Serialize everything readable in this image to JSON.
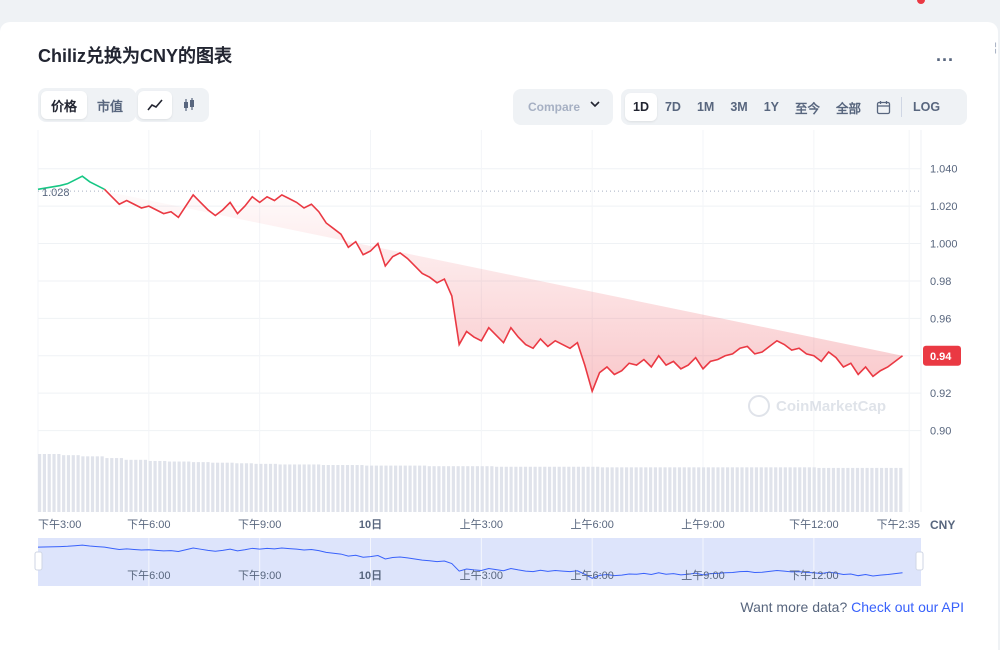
{
  "title": "Chiliz兑换为CNY的图表",
  "more_label": "...",
  "view_tabs": [
    {
      "label": "价格",
      "active": true
    },
    {
      "label": "市值",
      "active": false
    }
  ],
  "chart_type_icons": [
    "line-chart-icon",
    "candlestick-icon"
  ],
  "compare": {
    "label": "Compare"
  },
  "ranges": [
    {
      "label": "1D",
      "active": true
    },
    {
      "label": "7D",
      "active": false
    },
    {
      "label": "1M",
      "active": false
    },
    {
      "label": "3M",
      "active": false
    },
    {
      "label": "1Y",
      "active": false
    },
    {
      "label": "至今",
      "active": false
    },
    {
      "label": "全部",
      "active": false
    }
  ],
  "log_label": "LOG",
  "footer": {
    "text": "Want more data?",
    "link": "Check out our API"
  },
  "watermark": "CoinMarketCap",
  "colors": {
    "up": "#16c784",
    "down": "#ea3943",
    "accent": "#3861fb",
    "navigator": "#dde4fb"
  },
  "chart_data": {
    "type": "line",
    "currency": "CNY",
    "open_price": 1.028,
    "open_price_label": "1.028",
    "current_price": 0.94,
    "current_price_label": "0.94",
    "ylim": [
      0.88,
      1.05
    ],
    "y_ticks": [
      "1.040",
      "1.020",
      "1.000",
      "0.98",
      "0.96",
      "0.94",
      "0.92",
      "0.90"
    ],
    "y_tick_values": [
      1.04,
      1.02,
      1.0,
      0.98,
      0.96,
      0.94,
      0.92,
      0.9
    ],
    "x_ticks": [
      "下午3:00",
      "下午6:00",
      "下午9:00",
      "10日",
      "上午3:00",
      "上午6:00",
      "上午9:00",
      "下午12:00",
      "下午2:35"
    ],
    "x_tick_hours": [
      0,
      3,
      6,
      9,
      12,
      15,
      18,
      21,
      23.58
    ],
    "navigator_ticks": [
      "下午6:00",
      "下午9:00",
      "10日",
      "上午3:00",
      "上午6:00",
      "上午9:00",
      "下午12:00"
    ],
    "navigator_tick_hours": [
      3,
      6,
      9,
      12,
      15,
      18,
      21
    ],
    "x_hours_range": [
      0,
      23.9
    ],
    "series": [
      {
        "x_hours": [
          0,
          0.6,
          0.8,
          1.0,
          1.2,
          1.4,
          1.6,
          1.8,
          2.0,
          2.2,
          2.4,
          2.6,
          2.8,
          3.0,
          3.2,
          3.4,
          3.6,
          3.8,
          4.0,
          4.2,
          4.4,
          4.6,
          4.8,
          5.0,
          5.2,
          5.4,
          5.6,
          5.8,
          6.0,
          6.2,
          6.4,
          6.6,
          6.8,
          7.0,
          7.2,
          7.4,
          7.6,
          7.8,
          8.0,
          8.2,
          8.4,
          8.6,
          8.8,
          9.0,
          9.2,
          9.4,
          9.6,
          9.8,
          10.0,
          10.2,
          10.4,
          10.6,
          10.8,
          11.0,
          11.2,
          11.4,
          11.6,
          11.8,
          12.0,
          12.2,
          12.4,
          12.6,
          12.8,
          13.0,
          13.2,
          13.4,
          13.6,
          13.8,
          14.0,
          14.2,
          14.4,
          14.6,
          14.8,
          15.0,
          15.2,
          15.4,
          15.6,
          15.8,
          16.0,
          16.2,
          16.4,
          16.6,
          16.8,
          17.0,
          17.2,
          17.4,
          17.6,
          17.8,
          18.0,
          18.2,
          18.4,
          18.6,
          18.8,
          19.0,
          19.2,
          19.4,
          19.6,
          19.8,
          20.0,
          20.2,
          20.4,
          20.6,
          20.8,
          21.0,
          21.2,
          21.4,
          21.6,
          21.8,
          22.0,
          22.2,
          22.4,
          22.6,
          22.8,
          23.0,
          23.2,
          23.4,
          23.6,
          23.9
        ],
        "values": [
          1.029,
          1.031,
          1.032,
          1.034,
          1.036,
          1.033,
          1.031,
          1.029,
          1.025,
          1.021,
          1.023,
          1.021,
          1.019,
          1.02,
          1.018,
          1.016,
          1.017,
          1.014,
          1.02,
          1.026,
          1.022,
          1.018,
          1.015,
          1.018,
          1.022,
          1.016,
          1.02,
          1.025,
          1.022,
          1.025,
          1.023,
          1.026,
          1.024,
          1.022,
          1.019,
          1.021,
          1.017,
          1.011,
          1.008,
          1.005,
          0.998,
          1.001,
          0.994,
          0.996,
          1.0,
          0.988,
          0.993,
          0.995,
          0.992,
          0.988,
          0.984,
          0.982,
          0.979,
          0.981,
          0.972,
          0.946,
          0.953,
          0.95,
          0.948,
          0.955,
          0.951,
          0.947,
          0.955,
          0.95,
          0.946,
          0.944,
          0.949,
          0.945,
          0.948,
          0.946,
          0.944,
          0.947,
          0.935,
          0.921,
          0.931,
          0.934,
          0.93,
          0.932,
          0.936,
          0.935,
          0.938,
          0.934,
          0.94,
          0.935,
          0.937,
          0.933,
          0.935,
          0.939,
          0.933,
          0.937,
          0.938,
          0.94,
          0.941,
          0.944,
          0.945,
          0.941,
          0.942,
          0.945,
          0.948,
          0.946,
          0.943,
          0.944,
          0.941,
          0.94,
          0.937,
          0.942,
          0.939,
          0.934,
          0.936,
          0.93,
          0.934,
          0.929,
          0.932,
          0.934,
          0.937,
          0.94
        ]
      }
    ],
    "volume_relative": [
      1.0,
      0.98,
      0.96,
      0.93,
      0.9,
      0.88,
      0.87,
      0.86,
      0.85,
      0.84,
      0.83,
      0.82,
      0.82,
      0.81,
      0.81,
      0.8,
      0.8,
      0.8,
      0.79,
      0.79,
      0.79,
      0.78,
      0.78,
      0.78,
      0.78,
      0.78,
      0.77,
      0.77,
      0.77,
      0.77,
      0.77,
      0.77,
      0.77,
      0.77,
      0.77,
      0.77,
      0.76,
      0.76,
      0.76,
      0.76
    ]
  }
}
